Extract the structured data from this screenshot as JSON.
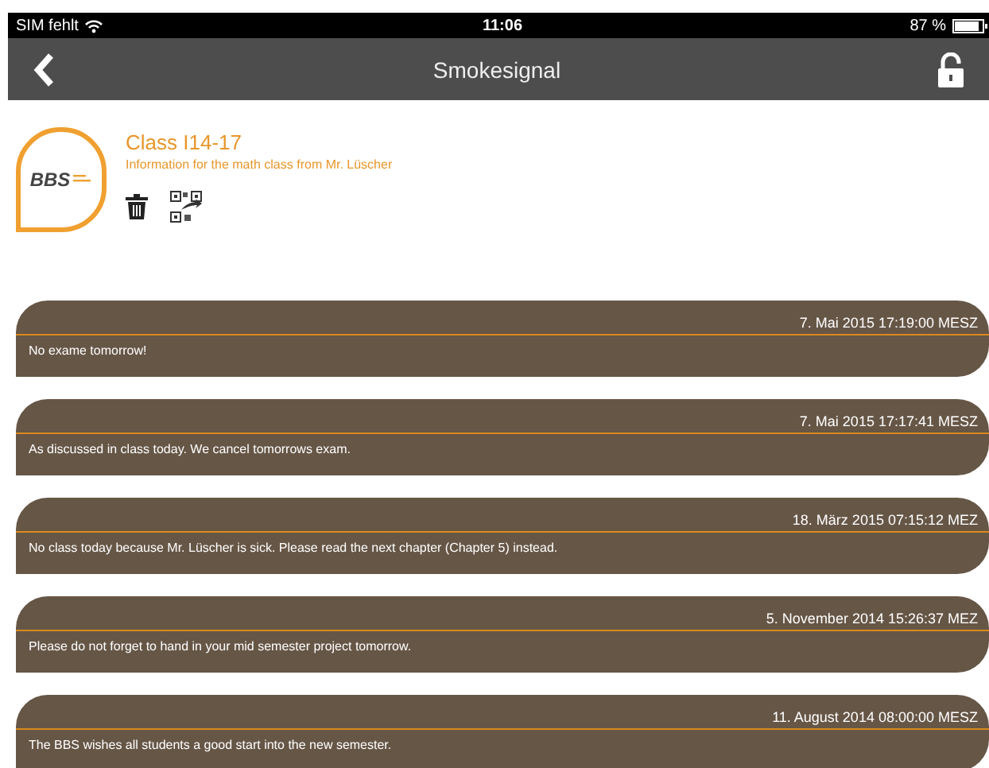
{
  "status_bar": {
    "carrier": "SIM fehlt",
    "time": "11:06",
    "battery": "87 %"
  },
  "nav_bar": {
    "title": "Smokesignal"
  },
  "channel": {
    "logo_text": "BBS",
    "title": "Class I14-17",
    "description": "Information for the math class from Mr. Lüscher"
  },
  "messages": [
    {
      "timestamp": "7. Mai 2015 17:19:00 MESZ",
      "text": "No exame tomorrow!"
    },
    {
      "timestamp": "7. Mai 2015 17:17:41 MESZ",
      "text": "As discussed in class today. We cancel tomorrows exam."
    },
    {
      "timestamp": "18. März 2015 07:15:12 MEZ",
      "text": "No class today because Mr. Lüscher is sick. Please read the next chapter (Chapter 5) instead."
    },
    {
      "timestamp": "5. November 2014 15:26:37 MEZ",
      "text": "Please do not forget to hand in your mid semester project tomorrow."
    },
    {
      "timestamp": "11. August 2014 08:00:00 MESZ",
      "text": "The BBS wishes all students a good start into the new semester."
    }
  ]
}
